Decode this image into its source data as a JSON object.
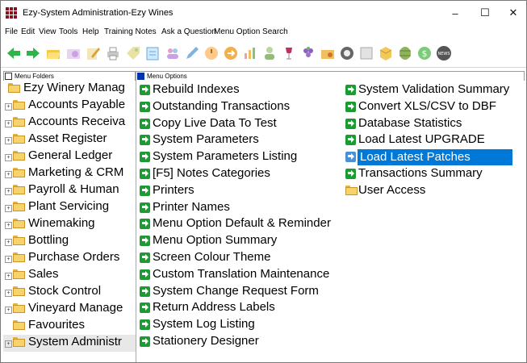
{
  "window": {
    "title": "Ezy-System Administration-Ezy Wines"
  },
  "menubar": [
    "File",
    "Edit",
    "View",
    "Tools",
    "Help",
    "Training Notes",
    "Ask a Question",
    "Menu Option Search"
  ],
  "left_pane": {
    "header": "Menu Folders",
    "items": [
      {
        "label": "Ezy Winery Manag",
        "expander": false
      },
      {
        "label": "Accounts Payable",
        "expander": true
      },
      {
        "label": "Accounts Receiva",
        "expander": true
      },
      {
        "label": "Asset Register",
        "expander": true
      },
      {
        "label": "General Ledger",
        "expander": true
      },
      {
        "label": "Marketing & CRM",
        "expander": true
      },
      {
        "label": "Payroll & Human",
        "expander": true
      },
      {
        "label": "Plant Servicing",
        "expander": true
      },
      {
        "label": "Winemaking",
        "expander": true
      },
      {
        "label": "Bottling",
        "expander": true
      },
      {
        "label": "Purchase Orders",
        "expander": true
      },
      {
        "label": "Sales",
        "expander": true
      },
      {
        "label": "Stock Control",
        "expander": true
      },
      {
        "label": "Vineyard Manage",
        "expander": true
      },
      {
        "label": "Favourites",
        "expander": false
      },
      {
        "label": "System Administr",
        "expander": true,
        "selected": true
      }
    ]
  },
  "right_pane": {
    "header": "Menu Options",
    "column1": [
      "Rebuild Indexes",
      "Outstanding Transactions",
      "Copy Live Data To Test",
      "System Parameters",
      "System Parameters Listing",
      "[F5] Notes Categories",
      "Printers",
      "Printer Names",
      "Menu Option Default & Reminder",
      "Menu Option Summary",
      "Screen Colour Theme",
      "Custom Translation Maintenance",
      "System Change Request Form",
      "Return Address Labels",
      "System Log Listing",
      "Stationery Designer"
    ],
    "column2": [
      {
        "label": "System Validation Summary",
        "kind": "arrow"
      },
      {
        "label": "Convert XLS/CSV to DBF",
        "kind": "arrow"
      },
      {
        "label": "Database Statistics",
        "kind": "arrow"
      },
      {
        "label": "Load Latest UPGRADE",
        "kind": "arrow"
      },
      {
        "label": "Load Latest Patches",
        "kind": "arrow",
        "selected": true
      },
      {
        "label": "Transactions Summary",
        "kind": "arrow"
      },
      {
        "label": "User Access",
        "kind": "folder"
      }
    ]
  },
  "toolbar_icons": [
    "back-arrow-icon",
    "forward-arrow-icon",
    "folder-open-icon",
    "folder-icon",
    "edit-icon",
    "printer-icon",
    "tag-icon",
    "notes-icon",
    "users-icon",
    "pencil-icon",
    "clock-icon",
    "export-icon",
    "chart-icon",
    "user-icon",
    "wine-icon",
    "grapes-icon",
    "folder-config-icon",
    "settings-gear-icon",
    "list-icon",
    "box-icon",
    "barrel-icon",
    "dollar-icon",
    "news-icon"
  ],
  "colors": {
    "selection": "#0078d7",
    "arrow_green": "#1d9b33",
    "folder_yellow": "#f6d36b",
    "app_icon": "#8b0f1c"
  }
}
